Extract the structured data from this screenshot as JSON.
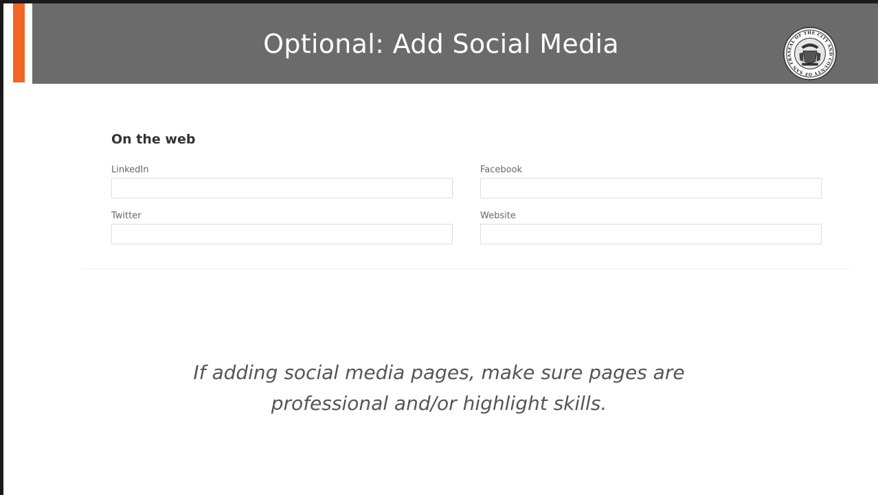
{
  "slide": {
    "title": "Optional:  Add Social Media",
    "seal_text": "SEAL OF THE CITY AND COUNTY OF SAN FRANCISCO"
  },
  "form": {
    "heading": "On the web",
    "fields": {
      "linkedin": {
        "label": "LinkedIn",
        "value": "",
        "placeholder": ""
      },
      "facebook": {
        "label": "Facebook",
        "value": "",
        "placeholder": ""
      },
      "twitter": {
        "label": "Twitter",
        "value": "",
        "placeholder": ""
      },
      "website": {
        "label": "Website",
        "value": "",
        "placeholder": ""
      }
    }
  },
  "caption": {
    "line1": "If adding social media pages, make sure pages are",
    "line2": "professional and/or highlight skills."
  },
  "colors": {
    "accent": "#f26522",
    "title_bar": "#6b6b6b",
    "title_text": "#ffffff"
  },
  "icons": {
    "seal": "city-seal-icon"
  }
}
